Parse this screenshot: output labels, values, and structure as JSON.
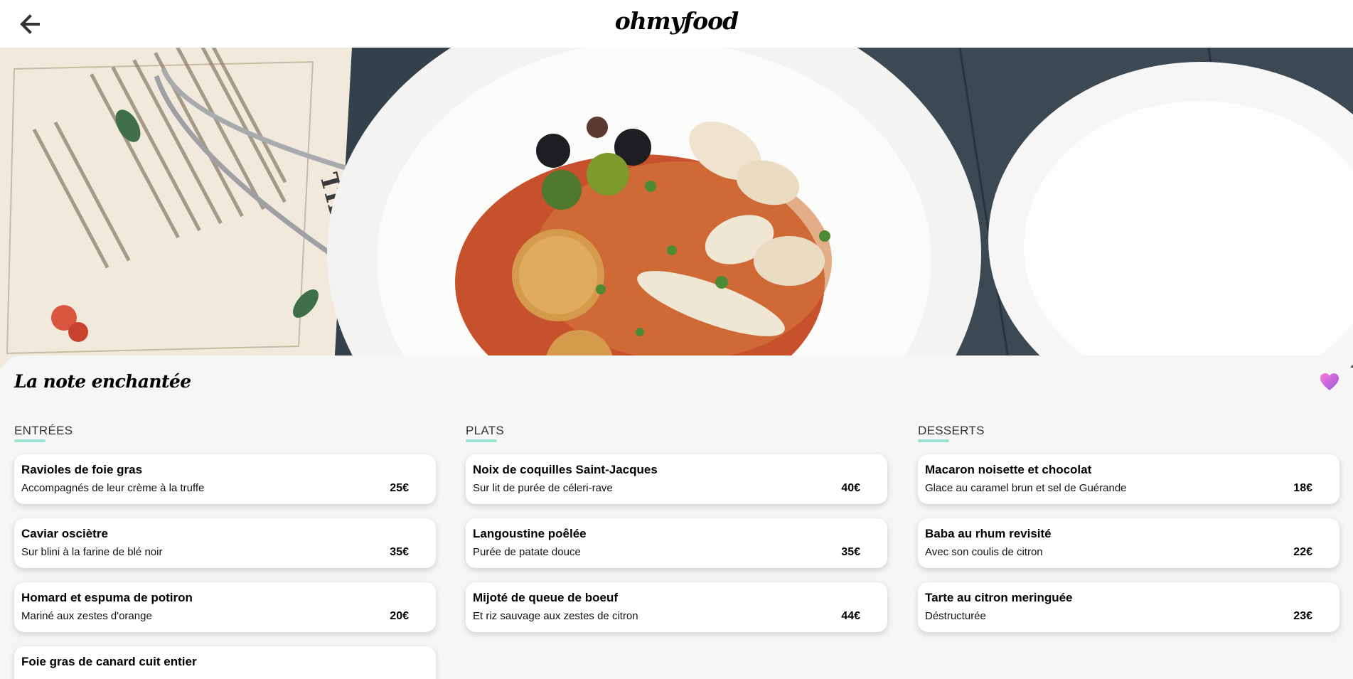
{
  "header": {
    "back_icon": "arrow-left-icon",
    "logo": "ohmyfood"
  },
  "restaurant": {
    "name": "La note enchantée",
    "favorite_icon": "heart-icon",
    "favorite_color": "#b35bd6"
  },
  "hero_image": {
    "menu_lines": [
      "THE BITES"
    ]
  },
  "accent_color": "#99e2d0",
  "sections": [
    {
      "title": "ENTRÉES",
      "items": [
        {
          "name": "Ravioles de foie gras",
          "description": "Accompagnés de leur crème à la truffe",
          "price": "25€"
        },
        {
          "name": "Caviar osciètre",
          "description": "Sur blini à la farine de blé noir",
          "price": "35€"
        },
        {
          "name": "Homard et espuma de potiron",
          "description": "Mariné aux zestes d'orange",
          "price": "20€"
        },
        {
          "name": "Foie gras de canard cuit entier",
          "description": "",
          "price": ""
        }
      ]
    },
    {
      "title": "PLATS",
      "items": [
        {
          "name": "Noix de coquilles Saint-Jacques",
          "description": "Sur lit de purée de céleri-rave",
          "price": "40€"
        },
        {
          "name": "Langoustine poêlée",
          "description": "Purée de patate douce",
          "price": "35€"
        },
        {
          "name": "Mijoté de queue de boeuf",
          "description": "Et riz sauvage aux zestes de citron",
          "price": "44€"
        }
      ]
    },
    {
      "title": "DESSERTS",
      "items": [
        {
          "name": "Macaron noisette et chocolat",
          "description": "Glace au caramel brun et sel de Guérande",
          "price": "18€"
        },
        {
          "name": "Baba au rhum revisité",
          "description": "Avec son coulis de citron",
          "price": "22€"
        },
        {
          "name": "Tarte au citron meringuée",
          "description": "Déstructurée",
          "price": "23€"
        }
      ]
    }
  ]
}
